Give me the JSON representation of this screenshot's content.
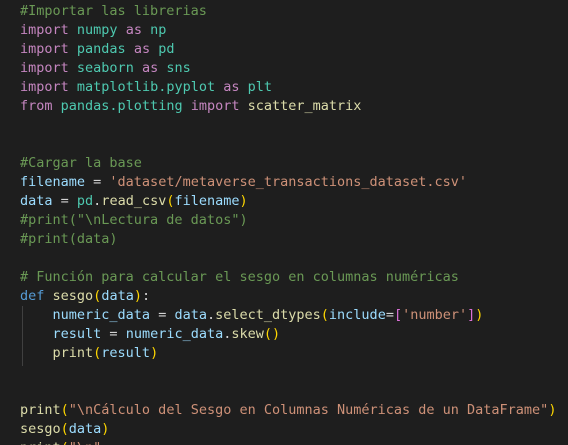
{
  "editor": {
    "background": "#1e1e1e",
    "theme": "dark",
    "lines": [
      [
        {
          "t": "#Importar las librerias",
          "c": "cmt"
        }
      ],
      [
        {
          "t": "import",
          "c": "kw"
        },
        {
          "t": " ",
          "c": "plain"
        },
        {
          "t": "numpy",
          "c": "mod"
        },
        {
          "t": " ",
          "c": "plain"
        },
        {
          "t": "as",
          "c": "kw"
        },
        {
          "t": " ",
          "c": "plain"
        },
        {
          "t": "np",
          "c": "mod"
        }
      ],
      [
        {
          "t": "import",
          "c": "kw"
        },
        {
          "t": " ",
          "c": "plain"
        },
        {
          "t": "pandas",
          "c": "mod"
        },
        {
          "t": " ",
          "c": "plain"
        },
        {
          "t": "as",
          "c": "kw"
        },
        {
          "t": " ",
          "c": "plain"
        },
        {
          "t": "pd",
          "c": "mod"
        }
      ],
      [
        {
          "t": "import",
          "c": "kw"
        },
        {
          "t": " ",
          "c": "plain"
        },
        {
          "t": "seaborn",
          "c": "mod"
        },
        {
          "t": " ",
          "c": "plain"
        },
        {
          "t": "as",
          "c": "kw"
        },
        {
          "t": " ",
          "c": "plain"
        },
        {
          "t": "sns",
          "c": "mod"
        }
      ],
      [
        {
          "t": "import",
          "c": "kw"
        },
        {
          "t": " ",
          "c": "plain"
        },
        {
          "t": "matplotlib.pyplot",
          "c": "mod"
        },
        {
          "t": " ",
          "c": "plain"
        },
        {
          "t": "as",
          "c": "kw"
        },
        {
          "t": " ",
          "c": "plain"
        },
        {
          "t": "plt",
          "c": "mod"
        }
      ],
      [
        {
          "t": "from",
          "c": "kw"
        },
        {
          "t": " ",
          "c": "plain"
        },
        {
          "t": "pandas.plotting",
          "c": "mod"
        },
        {
          "t": " ",
          "c": "plain"
        },
        {
          "t": "import",
          "c": "kw"
        },
        {
          "t": " ",
          "c": "plain"
        },
        {
          "t": "scatter_matrix",
          "c": "fn"
        }
      ],
      [],
      [],
      [
        {
          "t": "#Cargar la base",
          "c": "cmt"
        }
      ],
      [
        {
          "t": "filename",
          "c": "var"
        },
        {
          "t": " = ",
          "c": "plain"
        },
        {
          "t": "'dataset/metaverse_transactions_dataset.csv'",
          "c": "str"
        }
      ],
      [
        {
          "t": "data",
          "c": "var"
        },
        {
          "t": " = ",
          "c": "plain"
        },
        {
          "t": "pd",
          "c": "mod"
        },
        {
          "t": ".",
          "c": "plain"
        },
        {
          "t": "read_csv",
          "c": "fn"
        },
        {
          "t": "(",
          "c": "br1"
        },
        {
          "t": "filename",
          "c": "var"
        },
        {
          "t": ")",
          "c": "br1"
        }
      ],
      [
        {
          "t": "#print(\"\\nLectura de datos\")",
          "c": "cmt"
        }
      ],
      [
        {
          "t": "#print(data)",
          "c": "cmt"
        }
      ],
      [],
      [
        {
          "t": "# Función para calcular el sesgo en columnas numéricas",
          "c": "cmt"
        }
      ],
      [
        {
          "t": "def",
          "c": "def"
        },
        {
          "t": " ",
          "c": "plain"
        },
        {
          "t": "sesgo",
          "c": "fn"
        },
        {
          "t": "(",
          "c": "br1"
        },
        {
          "t": "data",
          "c": "var"
        },
        {
          "t": ")",
          "c": "br1"
        },
        {
          "t": ":",
          "c": "plain"
        }
      ],
      [
        {
          "t": "    ",
          "c": "plain"
        },
        {
          "t": "numeric_data",
          "c": "var"
        },
        {
          "t": " = ",
          "c": "plain"
        },
        {
          "t": "data",
          "c": "var"
        },
        {
          "t": ".",
          "c": "plain"
        },
        {
          "t": "select_dtypes",
          "c": "fn"
        },
        {
          "t": "(",
          "c": "br1"
        },
        {
          "t": "include",
          "c": "var"
        },
        {
          "t": "=",
          "c": "plain"
        },
        {
          "t": "[",
          "c": "br2"
        },
        {
          "t": "'number'",
          "c": "str"
        },
        {
          "t": "]",
          "c": "br2"
        },
        {
          "t": ")",
          "c": "br1"
        }
      ],
      [
        {
          "t": "    ",
          "c": "plain"
        },
        {
          "t": "result",
          "c": "var"
        },
        {
          "t": " = ",
          "c": "plain"
        },
        {
          "t": "numeric_data",
          "c": "var"
        },
        {
          "t": ".",
          "c": "plain"
        },
        {
          "t": "skew",
          "c": "fn"
        },
        {
          "t": "()",
          "c": "br1"
        }
      ],
      [
        {
          "t": "    ",
          "c": "plain"
        },
        {
          "t": "print",
          "c": "fn"
        },
        {
          "t": "(",
          "c": "br1"
        },
        {
          "t": "result",
          "c": "var"
        },
        {
          "t": ")",
          "c": "br1"
        }
      ],
      [],
      [],
      [
        {
          "t": "print",
          "c": "fn"
        },
        {
          "t": "(",
          "c": "br1"
        },
        {
          "t": "\"\\nCálculo del Sesgo en Columnas Numéricas de un DataFrame\"",
          "c": "str"
        },
        {
          "t": ")",
          "c": "br1"
        }
      ],
      [
        {
          "t": "sesgo",
          "c": "fn"
        },
        {
          "t": "(",
          "c": "br1"
        },
        {
          "t": "data",
          "c": "var"
        },
        {
          "t": ")",
          "c": "br1"
        }
      ],
      [
        {
          "t": "print",
          "c": "fn"
        },
        {
          "t": "(",
          "c": "br1"
        },
        {
          "t": "\"\\n\"",
          "c": "str"
        },
        {
          "t": "...",
          "c": "plain"
        }
      ]
    ]
  }
}
